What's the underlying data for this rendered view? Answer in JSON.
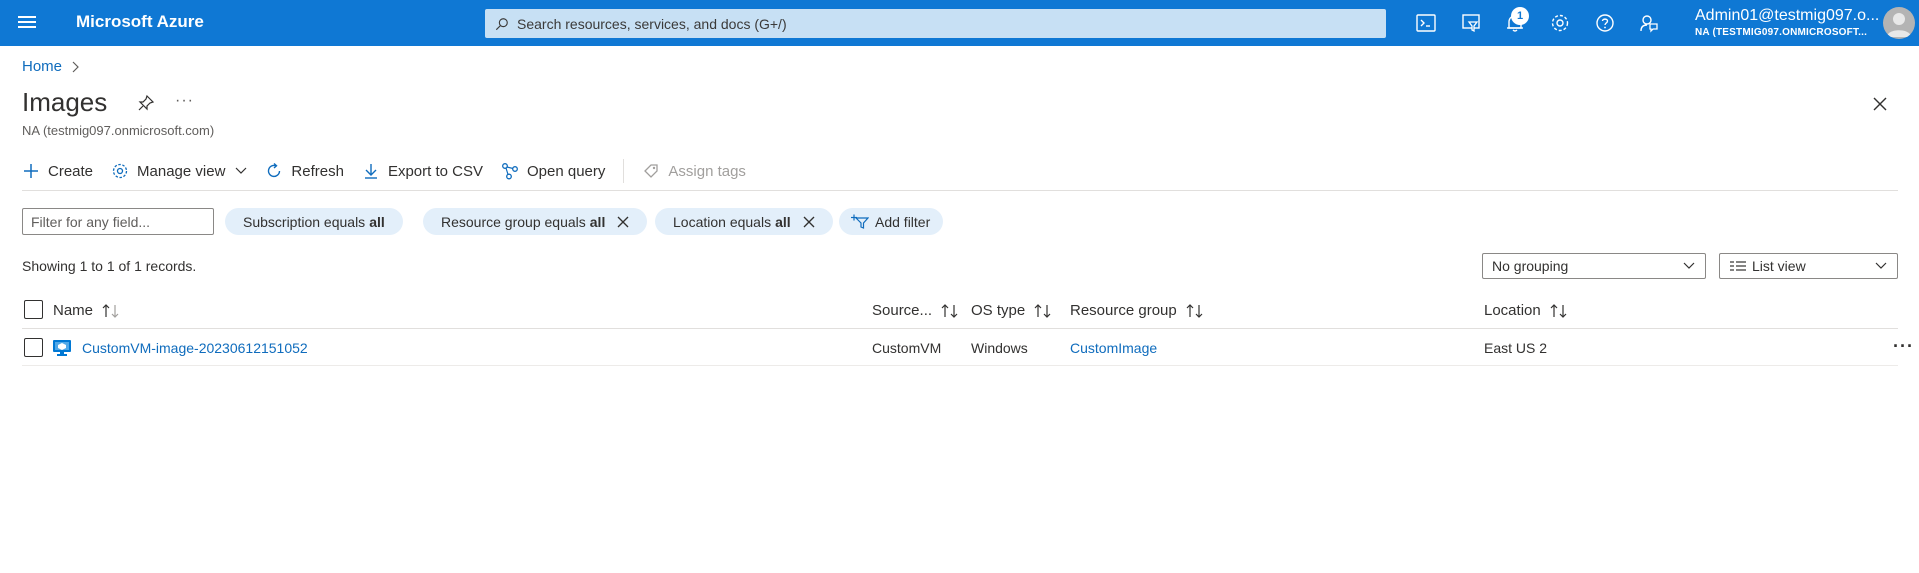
{
  "topbar": {
    "brand": "Microsoft Azure",
    "search_placeholder": "Search resources, services, and docs (G+/)",
    "notification_count": "1",
    "account_name": "Admin01@testmig097.o...",
    "account_tenant": "NA (TESTMIG097.ONMICROSOFT...",
    "accent_color": "#0f78d4"
  },
  "breadcrumb": {
    "home": "Home"
  },
  "page": {
    "title": "Images",
    "subtitle": "NA (testmig097.onmicrosoft.com)",
    "more": "···"
  },
  "toolbar": {
    "create": "Create",
    "manage_view": "Manage view",
    "refresh": "Refresh",
    "export_csv": "Export to CSV",
    "open_query": "Open query",
    "assign_tags": "Assign tags"
  },
  "filters": {
    "placeholder": "Filter for any field...",
    "subscription": {
      "label": "Subscription equals",
      "value": "all"
    },
    "resource_group": {
      "label": "Resource group equals",
      "value": "all"
    },
    "location": {
      "label": "Location equals",
      "value": "all"
    },
    "add_filter": "Add filter"
  },
  "records_text": "Showing 1 to 1 of 1 records.",
  "grouping": {
    "selected": "No grouping"
  },
  "view": {
    "selected": "List view"
  },
  "table": {
    "columns": {
      "name": "Name",
      "source": "Source...",
      "os_type": "OS type",
      "resource_group": "Resource group",
      "location": "Location"
    },
    "rows": [
      {
        "name": "CustomVM-image-20230612151052",
        "source": "CustomVM",
        "os_type": "Windows",
        "resource_group": "CustomImage",
        "location": "East US 2"
      }
    ]
  }
}
